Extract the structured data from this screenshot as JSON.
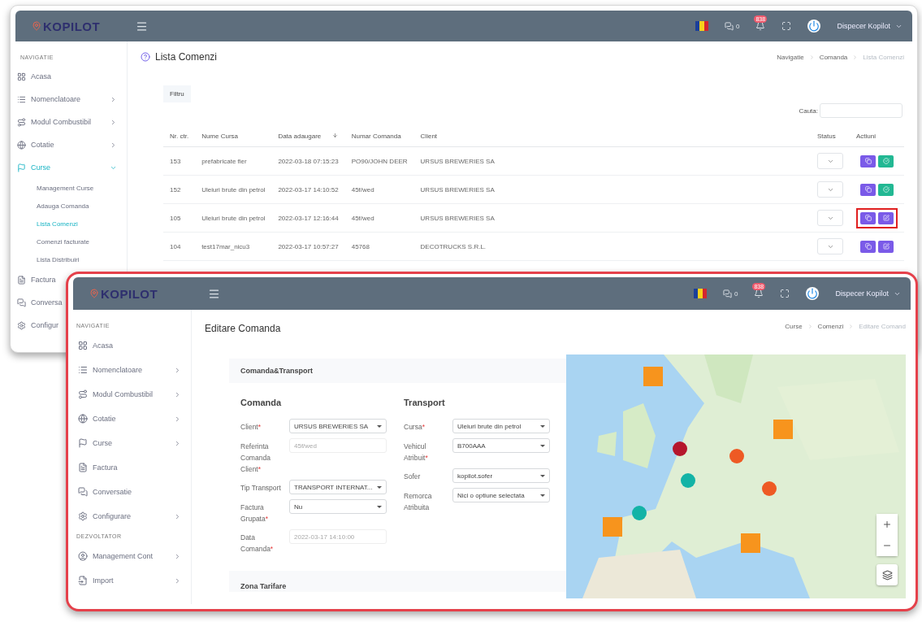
{
  "list_window": {
    "header": {
      "logo": "KOPILOT",
      "messages": "0",
      "notifications": "838",
      "user": "Dispecer Kopilot"
    },
    "sidebar": {
      "section": "NAVIGATIE",
      "items": [
        {
          "label": "Acasa",
          "has_submenu": false,
          "selected": false
        },
        {
          "label": "Nomenclatoare",
          "has_submenu": true,
          "expanded": false,
          "selected": false
        },
        {
          "label": "Modul Combustibil",
          "has_submenu": true,
          "expanded": false,
          "selected": false
        },
        {
          "label": "Cotatie",
          "has_submenu": true,
          "expanded": false,
          "selected": false
        },
        {
          "label": "Curse",
          "has_submenu": true,
          "expanded": true,
          "selected": true,
          "children": [
            {
              "label": "Management Curse",
              "selected": false
            },
            {
              "label": "Adauga Comanda",
              "selected": false
            },
            {
              "label": "Lista Comenzi",
              "selected": true
            },
            {
              "label": "Comenzi facturate",
              "selected": false
            },
            {
              "label": "Lista Distribuiri",
              "selected": false
            }
          ]
        },
        {
          "label": "Factura",
          "selected": false
        },
        {
          "label": "Conversa",
          "selected": false
        },
        {
          "label": "Configur",
          "selected": false
        }
      ]
    },
    "page_title": "Lista Comenzi",
    "breadcrumbs": [
      "Navigatie",
      "Comanda",
      "Lista Comenzi"
    ],
    "filter_button": "Filtru",
    "search": {
      "label": "Cauta:"
    },
    "table": {
      "columns": [
        {
          "label": "Nr. ctr.",
          "sorted": false
        },
        {
          "label": "Nume Cursa",
          "sorted": false
        },
        {
          "label": "Data adaugare",
          "sorted": true
        },
        {
          "label": "Numar Comanda",
          "sorted": false
        },
        {
          "label": "Client",
          "sorted": false
        },
        {
          "label": "Status",
          "sorted": false
        },
        {
          "label": "Actiuni",
          "sorted": false
        }
      ],
      "rows": [
        {
          "cells": [
            "153",
            "prefabricate fier",
            "2022-03-18 07:15:23",
            "PO90/JOHN DEER",
            "URSUS BREWERIES SA"
          ],
          "highlighted": false,
          "actions": [
            {
              "kind": "copy"
            },
            {
              "kind": "approve"
            }
          ]
        },
        {
          "cells": [
            "152",
            "Uleiuri brute din petrol",
            "2022-03-17 14:10:52",
            "45f/wed",
            "URSUS BREWERIES SA"
          ],
          "highlighted": false,
          "actions": [
            {
              "kind": "copy"
            },
            {
              "kind": "approve"
            }
          ]
        },
        {
          "cells": [
            "105",
            "Uleiuri brute din petrol",
            "2022-03-17 12:16:44",
            "45f/wed",
            "URSUS BREWERIES SA"
          ],
          "highlighted": true,
          "actions": [
            {
              "kind": "copy"
            },
            {
              "kind": "edit"
            }
          ]
        },
        {
          "cells": [
            "104",
            "test17mar_nicu3",
            "2022-03-17 10:57:27",
            "45768",
            "DECOTRUCKS S.R.L."
          ],
          "highlighted": false,
          "actions": [
            {
              "kind": "copy"
            },
            {
              "kind": "edit"
            }
          ]
        }
      ]
    }
  },
  "edit_window": {
    "header": {
      "logo": "KOPILOT",
      "messages": "0",
      "notifications": "838",
      "user": "Dispecer Kopilot"
    },
    "sidebar": [
      {
        "section": "NAVIGATIE",
        "items": [
          {
            "label": "Acasa",
            "has_submenu": false
          },
          {
            "label": "Nomenclatoare",
            "has_submenu": true
          },
          {
            "label": "Modul Combustibil",
            "has_submenu": true
          },
          {
            "label": "Cotatie",
            "has_submenu": true
          },
          {
            "label": "Curse",
            "has_submenu": true
          },
          {
            "label": "Factura",
            "has_submenu": false
          },
          {
            "label": "Conversatie",
            "has_submenu": false
          },
          {
            "label": "Configurare",
            "has_submenu": true
          }
        ]
      },
      {
        "section": "DEZVOLTATOR",
        "items": [
          {
            "label": "Management Cont",
            "has_submenu": true
          },
          {
            "label": "Import",
            "has_submenu": true
          }
        ]
      }
    ],
    "page_title": "Editare Comanda",
    "breadcrumbs": [
      "Curse",
      "Comenzi",
      "Editare Comand"
    ],
    "card_title": "Comanda&Transport",
    "columns": [
      {
        "title": "Comanda",
        "fields": [
          {
            "label": "Client",
            "required_mark": "*",
            "kind": "select",
            "value": "URSUS BREWERIES SA"
          },
          {
            "label": "Referinta Comanda Client",
            "required_mark": "*",
            "kind": "readonly",
            "value": "45f/wed"
          },
          {
            "label": "Tip Transport",
            "kind": "select",
            "value": "TRANSPORT INTERNAT..."
          },
          {
            "label": "Factura Grupata",
            "required_mark": "*",
            "kind": "select",
            "value": "Nu"
          },
          {
            "label": "Data Comanda",
            "required_mark": "*",
            "kind": "readonly",
            "value": "2022-03-17 14:10:00"
          }
        ]
      },
      {
        "title": "Transport",
        "fields": [
          {
            "label": "Cursa",
            "required_mark": "*",
            "kind": "select",
            "value": "Uleiuri brute din petrol"
          },
          {
            "label": "Vehicul Atribuit",
            "required_mark": "*",
            "kind": "select",
            "value": "B700AAA"
          },
          {
            "label": "Sofer",
            "kind": "select",
            "value": "kopilot.sofer"
          },
          {
            "label": "Remorca Atribuita",
            "kind": "select",
            "value": "Nici o optiune selectata"
          }
        ]
      }
    ],
    "next_section": "Zona Tarifare",
    "map": {
      "kind": "picture"
    }
  }
}
